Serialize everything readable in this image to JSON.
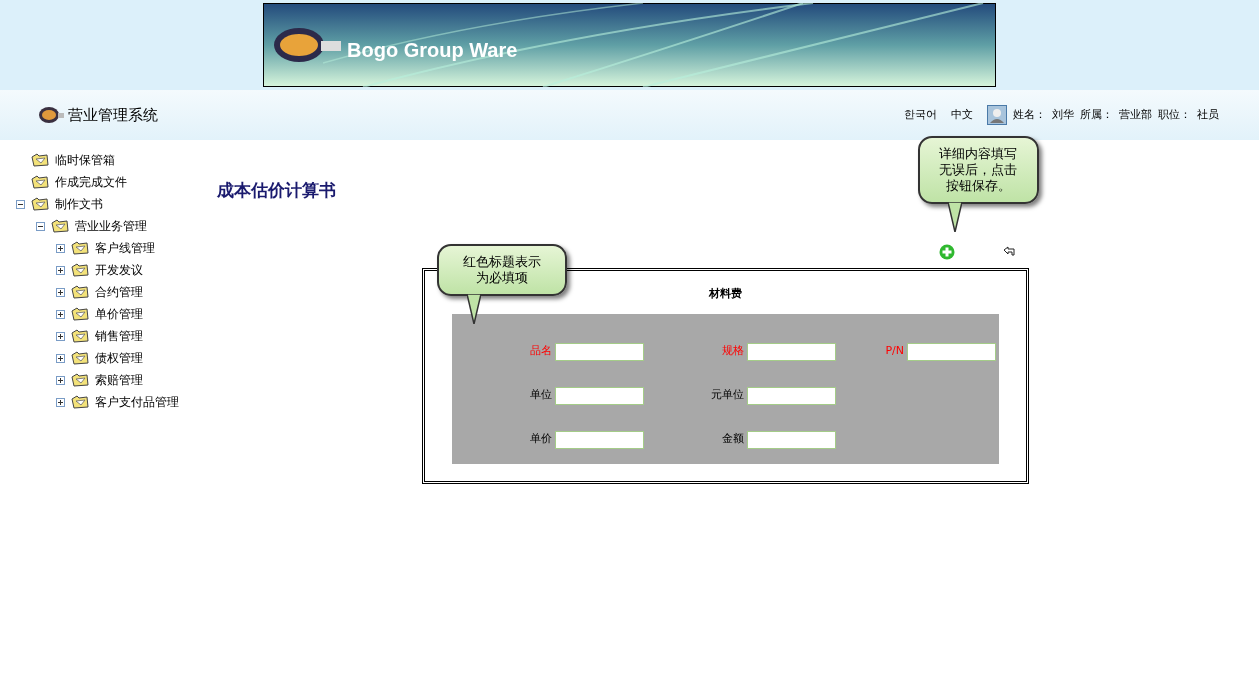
{
  "banner": {
    "title": "Bogo Group Ware"
  },
  "header": {
    "system_title": "营业管理系统",
    "languages": [
      "한국어",
      "中文"
    ],
    "user": [
      {
        "label": "姓名：",
        "value": "刘华"
      },
      {
        "label": "所属：",
        "value": "营业部"
      },
      {
        "label": "职位：",
        "value": "社员"
      }
    ]
  },
  "sidebar": {
    "tree": [
      {
        "label": "临时保管箱",
        "kind": "folder"
      },
      {
        "label": "作成完成文件",
        "kind": "folder"
      },
      {
        "label": "制作文书",
        "kind": "group",
        "expanded": true,
        "children": [
          {
            "label": "营业业务管理",
            "kind": "group",
            "expanded": true,
            "children": [
              {
                "label": "客户线管理",
                "kind": "group",
                "expanded": false
              },
              {
                "label": "开发发议",
                "kind": "group",
                "expanded": false
              },
              {
                "label": "合约管理",
                "kind": "group",
                "expanded": false
              },
              {
                "label": "单价管理",
                "kind": "group",
                "expanded": false
              },
              {
                "label": "销售管理",
                "kind": "group",
                "expanded": false
              },
              {
                "label": "债权管理",
                "kind": "group",
                "expanded": false
              },
              {
                "label": "索赔管理",
                "kind": "group",
                "expanded": false
              },
              {
                "label": "客户支付品管理",
                "kind": "group",
                "expanded": false
              }
            ]
          }
        ]
      }
    ]
  },
  "page_title": "成本估价计算书",
  "callouts": [
    {
      "text": "详细内容填写无误后，点击按钮保存。"
    },
    {
      "text": "红色标题表示为必填项"
    }
  ],
  "form": {
    "title": "材料费",
    "rows": [
      [
        {
          "label": "品名",
          "required": true
        },
        {
          "label": "规格",
          "required": true
        },
        {
          "label": "P/N",
          "required": true
        }
      ],
      [
        {
          "label": "单位",
          "required": false
        },
        {
          "label": "元单位",
          "required": false
        }
      ],
      [
        {
          "label": "单价",
          "required": false
        },
        {
          "label": "金额",
          "required": false
        }
      ]
    ]
  }
}
